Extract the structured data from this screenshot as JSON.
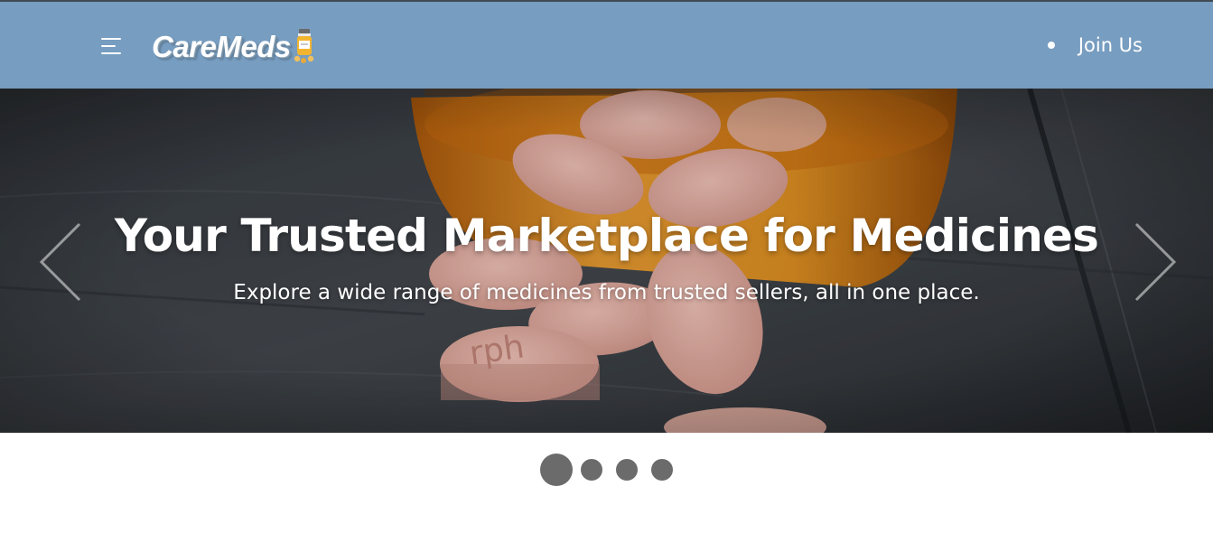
{
  "navbar": {
    "logo_text": "CareMeds",
    "join_label": "Join Us",
    "background_color": "#779dc0"
  },
  "hero": {
    "title": "Your Trusted Marketplace for Medicines",
    "subtitle": "Explore a wide range of medicines from trusted sellers, all in one place.",
    "pill_imprint": "rph"
  },
  "carousel": {
    "slide_count": 4,
    "active_index": 0
  },
  "icons": {
    "menu": "hamburger-menu-icon",
    "logo": "medicine-bottle-icon",
    "prev": "chevron-left-icon",
    "next": "chevron-right-icon"
  }
}
